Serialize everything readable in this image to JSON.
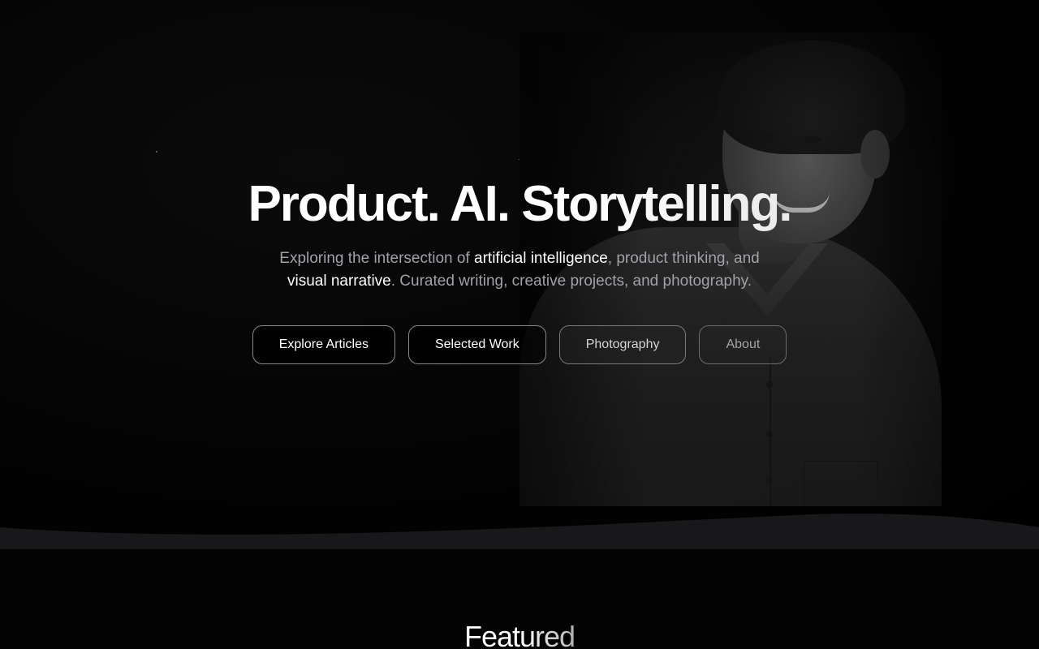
{
  "hero": {
    "title": "Product. AI. Storytelling.",
    "subtitle": {
      "part1": "Exploring the intersection of ",
      "highlight1": "artificial intelligence",
      "part2": ", product thinking, and ",
      "highlight2": "visual narrative",
      "part3": ". Curated writing, creative projects, and photography."
    },
    "buttons": [
      {
        "label": "Explore Articles"
      },
      {
        "label": "Selected Work"
      },
      {
        "label": "Photography"
      },
      {
        "label": "About"
      }
    ],
    "portrait_icon": "portrait-photo"
  },
  "featured": {
    "title": "Featured"
  },
  "colors": {
    "background": "#000000",
    "text_primary": "#ffffff",
    "text_secondary": "#a1a1aa",
    "button_border": "#8a8a8a"
  }
}
